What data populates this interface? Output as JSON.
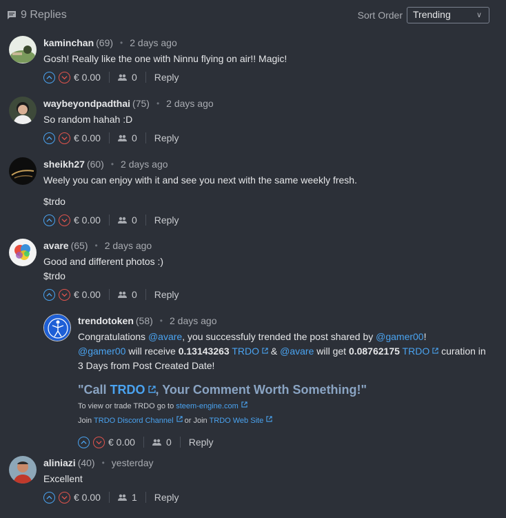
{
  "header": {
    "replies_label": "9 Replies",
    "sort_label": "Sort Order",
    "sort_value": "Trending"
  },
  "comments": [
    {
      "author": "kaminchan",
      "rep": "(69)",
      "time": "2 days ago",
      "text": "Gosh! Really like the one with Ninnu flying on air!! Magic!",
      "payout": "€ 0.00",
      "votes": "0",
      "reply": "Reply"
    },
    {
      "author": "waybeyondpadthai",
      "rep": "(75)",
      "time": "2 days ago",
      "text": "So random hahah :D",
      "payout": "€ 0.00",
      "votes": "0",
      "reply": "Reply"
    },
    {
      "author": "sheikh27",
      "rep": "(60)",
      "time": "2 days ago",
      "text": "Weely you can enjoy with it and see you next with the same weekly fresh.",
      "text2": "$trdo",
      "payout": "€ 0.00",
      "votes": "0",
      "reply": "Reply"
    },
    {
      "author": "avare",
      "rep": "(65)",
      "time": "2 days ago",
      "text": "Good and different photos :)",
      "text2": "$trdo",
      "payout": "€ 0.00",
      "votes": "0",
      "reply": "Reply"
    },
    {
      "author": "trendotoken",
      "rep": "(58)",
      "time": "2 days ago",
      "line1_a": "Congratulations ",
      "line1_mention": "@avare",
      "line1_b": ", you successfuly trended the post shared by ",
      "line1_mention2": "@gamer00",
      "line1_c": "!",
      "line2_mention": "@gamer00",
      "line2_a": " will receive ",
      "line2_amount": "0.13143263",
      "line2_token": "TRDO",
      "line2_b": " & ",
      "line2_mention2": "@avare",
      "line2_c": " will get ",
      "line2_amount2": "0.08762175",
      "line2_token2": "TRDO",
      "line2_d": " curation in",
      "line3": "3 Days from Post Created Date!",
      "quote_a": "\"Call ",
      "quote_token": "TRDO",
      "quote_b": ", Your Comment Worth Something!\"",
      "small1_a": "To view or trade TRDO go to ",
      "small1_link": "steem-engine.com",
      "small2_a": "Join ",
      "small2_link": "TRDO Discord Channel",
      "small2_b": " or Join ",
      "small2_link2": "TRDO Web Site",
      "payout": "€ 0.00",
      "votes": "0",
      "reply": "Reply"
    },
    {
      "author": "aliniazi",
      "rep": "(40)",
      "time": "yesterday",
      "text": "Excellent",
      "payout": "€ 0.00",
      "votes": "1",
      "reply": "Reply"
    }
  ],
  "colors": {
    "background": "#2c3038",
    "accent": "#4aa3f0",
    "downvote": "#e0544d"
  }
}
